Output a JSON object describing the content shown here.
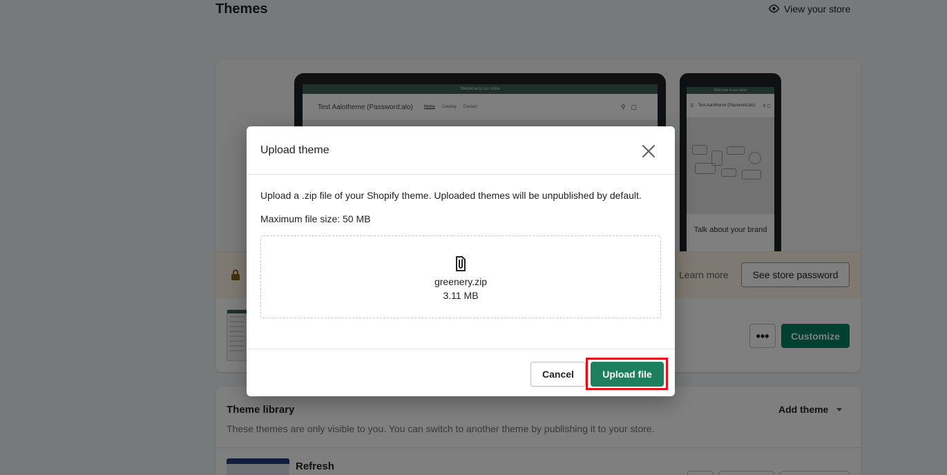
{
  "page": {
    "title": "Themes",
    "view_store_label": "View your store"
  },
  "current_theme": {
    "desktop_preview": {
      "announcement": "Welcome to our store",
      "store_name": "Test Aalotheme (Password:alo)",
      "nav": [
        "Home",
        "Catalog",
        "Contact"
      ]
    },
    "mobile_preview": {
      "announcement": "Welcome to our store",
      "store_name": "Test Aalotheme (Password:alo)",
      "hero_text": "Talk about your brand"
    },
    "notice": {
      "learn_more_label": "Learn more",
      "see_password_label": "See store password"
    },
    "more_label": "•••",
    "customize_label": "Customize"
  },
  "theme_library": {
    "title": "Theme library",
    "description": "These themes are only visible to you. You can switch to another theme by publishing it to your store.",
    "add_theme_label": "Add theme",
    "items": [
      {
        "name": "Refresh"
      }
    ]
  },
  "modal": {
    "title": "Upload theme",
    "description": "Upload a .zip file of your Shopify theme. Uploaded themes will be unpublished by default.",
    "max_size": "Maximum file size: 50 MB",
    "file": {
      "name": "greenery.zip",
      "size": "3.11 MB"
    },
    "cancel_label": "Cancel",
    "upload_label": "Upload file"
  },
  "colors": {
    "primary": "#008060",
    "highlight": "#e0111b",
    "overlay": "rgba(0,0,0,0.5)"
  },
  "icons": {
    "view_store": "eye-icon",
    "close": "close-icon",
    "file": "paperclip-icon",
    "notice": "lock-icon",
    "dropdown": "caret-down-icon"
  }
}
